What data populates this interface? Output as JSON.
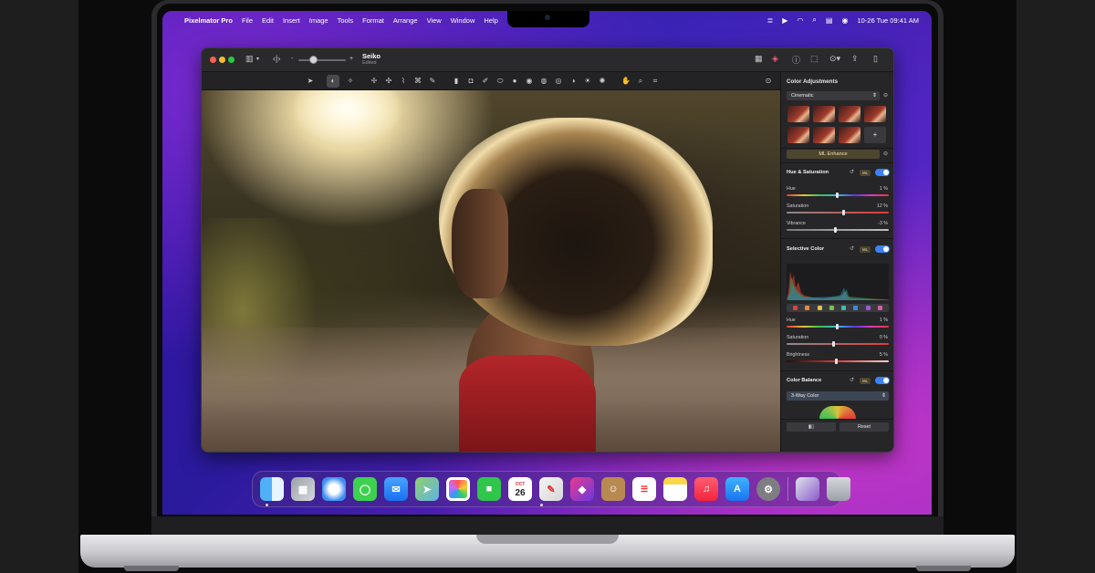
{
  "menubar": {
    "apple": "",
    "app_name": "Pixelmator Pro",
    "items": [
      "File",
      "Edit",
      "Insert",
      "Image",
      "Tools",
      "Format",
      "Arrange",
      "View",
      "Window",
      "Help"
    ],
    "clock": "10-26 Tue 09:41 AM"
  },
  "window": {
    "doc_name": "Seiko",
    "doc_status": "Edited"
  },
  "inspector": {
    "title": "Color Adjustments",
    "preset_dropdown": "Cinematic",
    "add_preset": "+",
    "ml_enhance": "ML Enhance",
    "hue_saturation": {
      "title": "Hue & Saturation",
      "ml_badge": "ML",
      "sliders": [
        {
          "label": "Hue",
          "value": "1 %"
        },
        {
          "label": "Saturation",
          "value": "12 %"
        },
        {
          "label": "Vibrance",
          "value": "-3 %"
        }
      ]
    },
    "selective_color": {
      "title": "Selective Color",
      "ml_badge": "ML",
      "swatch_colors": [
        "#d8443a",
        "#e88a3a",
        "#e0c24a",
        "#7cc24a",
        "#3fbfa8",
        "#3a8ae0",
        "#9a5ad8",
        "#d85aa8"
      ],
      "sliders": [
        {
          "label": "Hue",
          "value": "1 %"
        },
        {
          "label": "Saturation",
          "value": "0 %"
        },
        {
          "label": "Brightness",
          "value": "5 %"
        }
      ]
    },
    "color_balance": {
      "title": "Color Balance",
      "ml_badge": "ML",
      "mode_dropdown": "3-Way Color"
    },
    "reset_button": "Reset"
  },
  "dock": {
    "calendar_month": "OCT",
    "calendar_day": "26"
  },
  "colors": {
    "accent": "#3b82f6",
    "ml_gold": "#f3e3a7",
    "red_dress": "#b3262a"
  }
}
